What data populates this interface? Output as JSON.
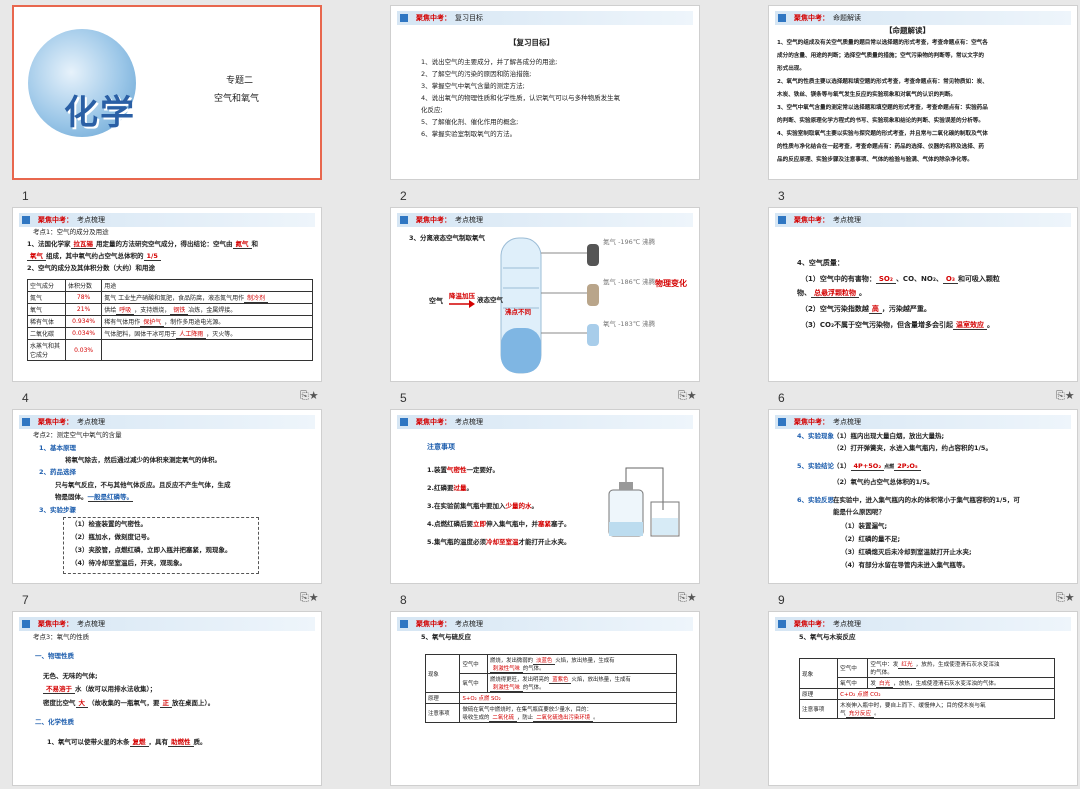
{
  "slides": {
    "s1": {
      "number": "1",
      "topic": "专题二",
      "subtitle": "空气和氧气",
      "logo_text": "化学"
    },
    "s2": {
      "number": "2",
      "header_red": "聚焦中考：",
      "header_title": "复习目标",
      "box_title": "【复习目标】",
      "items": [
        "1、说出空气的主要成分，并了解各成分的用途;",
        "2、了解空气的污染的原因和防治措施;",
        "3、掌握空气中氧气含量的测定方法;",
        "4、说出氧气的物理性质和化学性质，认识氧气可以与多种物质发生氧",
        "化反应;",
        "5、了解催化剂、催化作用的概念;",
        "6、掌握实验室制取氧气的方法。"
      ]
    },
    "s3": {
      "number": "3",
      "header_red": "聚焦中考：",
      "header_title": "命题解读",
      "box_title": "【命题解读】",
      "lines": [
        "1、空气的组成及有关空气质量的题目常以选择题的形式考查，考查命题点有：空气各",
        "成分的含量、用途的判断；选择空气质量的措施；空气污染物的判断等，常以文字的",
        "形式出现。",
        "2、氧气的性质主要以选择题和填空题的形式考查，考查命题点有：常见物质如：炭、",
        "木炭、铁丝、镁条等与氧气发生反应的实验现象和对氧气的认识的判断。",
        "3、空气中氧气含量的测定常以选择题和填空题的形式考查，考查命题点有：实验药品",
        "的判断、实验原理化学方程式的书写、实验现象和结论的判断、实验误差的分析等。",
        "4、实验室制取氧气主要以实验与探究题的形式考查，并且常与二氧化碳的制取及气体",
        "的性质与净化结合在一起考查，考查命题点有：药品的选择、仪器的名称及选择、药",
        "品的反应原理、实验步骤及注意事项、气体的检验与验满、气体的除杂净化等。"
      ]
    },
    "s4": {
      "number": "4",
      "header_red": "聚焦中考：",
      "header_title": "考点梳理",
      "point": "考点1：空气的成分及用途",
      "line1a": "1、法国化学家",
      "line1b": "拉瓦锡",
      "line1c": "用定量的方法研究空气成分，得出结论：空气由",
      "line1d": "氮气",
      "line1e": "和",
      "line2a": "氧气",
      "line2b": "组成，其中氧气约占空气总体积的",
      "line2c": "1/5",
      "line3": "2、空气的成分及其体积分数（大约）和用途",
      "table_head": [
        "空气成分",
        "体积分数",
        "用途"
      ],
      "rows": [
        {
          "name": "氮气",
          "pct": "78%",
          "use_a": "氮气 工业生产硝酸和氮肥，食品防腐，液态氮气用作",
          "use_b": "制冷剂"
        },
        {
          "name": "氧气",
          "pct": "21%",
          "use_a": "供给",
          "use_b": "呼吸",
          "use_c": "，支持燃烧，",
          "use_d": "钢铁",
          "use_e": "冶炼，金属焊接。"
        },
        {
          "name": "稀有气体",
          "pct": "0.934%",
          "use_a": "稀有气体用作",
          "use_b": "保护气",
          "use_c": "，制作多用途电光源。"
        },
        {
          "name": "二氧化碳",
          "pct": "0.034%",
          "use_a": "气体肥料，固体干冰可用于",
          "use_b": "人工降雨",
          "use_c": "，灭火等。"
        },
        {
          "name": "水蒸气和其它成分",
          "pct": "0.03%",
          "use_a": ""
        }
      ]
    },
    "s5": {
      "number": "5",
      "header_red": "聚焦中考：",
      "header_title": "考点梳理",
      "line": "3、分离液态空气制取氧气",
      "air": "空气",
      "step1": "降温加压",
      "liquid_air": "液态空气",
      "boil": "沸点不同",
      "n2": "氮气 -196℃ 沸腾",
      "ar": "氩气 -186℃ 沸腾",
      "o2": "氧气 -183℃ 沸腾",
      "change": "物理变化"
    },
    "s6": {
      "number": "6",
      "header_red": "聚焦中考：",
      "header_title": "考点梳理",
      "title": "4、空气质量：",
      "l1a": "（1）空气中的有害物：",
      "l1b": "SO₂",
      "l1c": "、CO、NO₂、",
      "l1d": "O₃",
      "l1e": "和可吸入颗粒",
      "l2a": "物、",
      "l2b": "总悬浮颗粒物",
      "l2c": "。",
      "l3a": "（2）空气污染指数越",
      "l3b": "高",
      "l3c": "，污染越严重。",
      "l4a": "（3）CO₂不属于空气污染物，但含量增多会引起",
      "l4b": "温室效应",
      "l4c": "。"
    },
    "s7": {
      "number": "7",
      "header_red": "聚焦中考：",
      "header_title": "考点梳理",
      "point": "考点2：测定空气中氧气的含量",
      "h1": "1、基本原理",
      "t1": "将氧气除去，然后通过减少的体积来测定氧气的体积。",
      "h2": "2、药品选择",
      "t2a": "只与氧气反应，不与其他气体反应。且反应不产生气体，生成",
      "t2b": "物是固体。",
      "t2c": "一般是红磷等。",
      "h3": "3、实验步骤",
      "steps": [
        "（1）检查装置的气密性。",
        "（2）瓶加水，做刻度记号。",
        "（3）夹胶管，点燃红磷，立即入瓶并把塞紧，观现象。",
        "（4）待冷却至室温后，开夹，观现象。"
      ]
    },
    "s8": {
      "number": "8",
      "header_red": "聚焦中考：",
      "header_title": "考点梳理",
      "title": "注意事项",
      "items": [
        {
          "a": "1.装置",
          "b": "气密性",
          "c": "一定要好。"
        },
        {
          "a": "2.红磷要",
          "b": "过量",
          "c": "。"
        },
        {
          "a": "3.在实验前集气瓶中要加入",
          "b": "少量的水",
          "c": "。"
        },
        {
          "a": "4.点燃红磷后要",
          "b": "立即",
          "c": "伸入集气瓶中，并",
          "d": "塞紧",
          "e": "塞子。"
        },
        {
          "a": "5.集气瓶的温度必须",
          "b": "冷却至室温",
          "c": "才能打开止水夹。"
        }
      ]
    },
    "s9": {
      "number": "9",
      "header_red": "聚焦中考：",
      "header_title": "考点梳理",
      "h4": "4、实验现象",
      "p1": "（1）瓶内出现大量白烟，放出大量热;",
      "p2": "（2）打开弹簧夹，水进入集气瓶内，约占容积的1/5。",
      "h5": "5、实验结论",
      "c1a": "（1）",
      "c1b": "4P+5O₂",
      "c1c": "点燃",
      "c1d": "2P₂O₅",
      "c2": "（2）氧气约占空气总体积的1/5。",
      "h6": "6、实验反思",
      "r0": "在实验中，进入集气瓶内的水的体积常小于集气瓶容积的1/5，可",
      "r0b": "能是什么原因呢？",
      "r": [
        "（1）装置漏气;",
        "（2）红磷的量不足;",
        "（3）红磷熄灭后未冷却到室温就打开止水夹;",
        "（4）有部分水留在导管内未进入集气瓶等。"
      ]
    },
    "s10": {
      "number": "",
      "header_red": "聚焦中考：",
      "header_title": "考点梳理",
      "point": "考点3：氧气的性质",
      "h1": "一、物理性质",
      "l1": "无色、无味的气体;",
      "l2a": "不易溶于",
      "l2b": "水（故可以用排水法收集）；",
      "l3a": "密度比空气",
      "l3b": "大",
      "l3c": "（故收集的一瓶氧气，要",
      "l3d": "正",
      "l3e": "放在桌面上）。",
      "h2": "二、化学性质",
      "l4a": "1、氧气可以使带火星的木条",
      "l4b": "复燃",
      "l4c": "，具有",
      "l4d": "助燃性",
      "l4e": "质。"
    },
    "s11": {
      "number": "",
      "header_red": "聚焦中考：",
      "header_title": "考点梳理",
      "title": "5、氧气与硫反应",
      "col": [
        "现象",
        "原理",
        "注意事项"
      ],
      "air": "空气中",
      "oxy": "氧气中",
      "a1": "燃烧，发出微弱的",
      "a2": "淡蓝色",
      "a3": "火焰，放出热量，生成有",
      "a4": "刺激性气味",
      "a5": "的气体。",
      "b1": "燃烧得更旺，发出明亮的",
      "b2": "蓝紫色",
      "b3": "火焰，放出热量，生成有",
      "b4": "刺激性气味",
      "b5": "的气体。",
      "eq": "S+O₂ 点燃 SO₂",
      "n1": "做硫在氧气中燃烧时，在集气瓶底要放少量水，目的：",
      "n2": "吸收生成的",
      "n3": "二氧化硫",
      "n4": "，防止",
      "n5": "二氧化硫逸出污染环境",
      "n6": "。"
    },
    "s12": {
      "number": "",
      "header_red": "聚焦中考：",
      "header_title": "考点梳理",
      "title": "5、氧气与木炭反应",
      "col": [
        "现象",
        "原理",
        "注意事项"
      ],
      "air": "空气中",
      "oxy": "氧气中",
      "a1": "空气中：发",
      "a2": "红光",
      "a3": "，放热，生成使澄清石灰水变浑浊",
      "a4": "的气体。",
      "b1": "发",
      "b2": "白光",
      "b3": "，放热，生成使澄清石灰水变浑浊的气体。",
      "eq": "C+O₂ 点燃 CO₂",
      "n1": "木炭伸入瓶中时，要自上而下、缓慢伸入；目的使木炭与氧",
      "n2": "气",
      "n3": "充分反应",
      "n4": "。"
    }
  }
}
